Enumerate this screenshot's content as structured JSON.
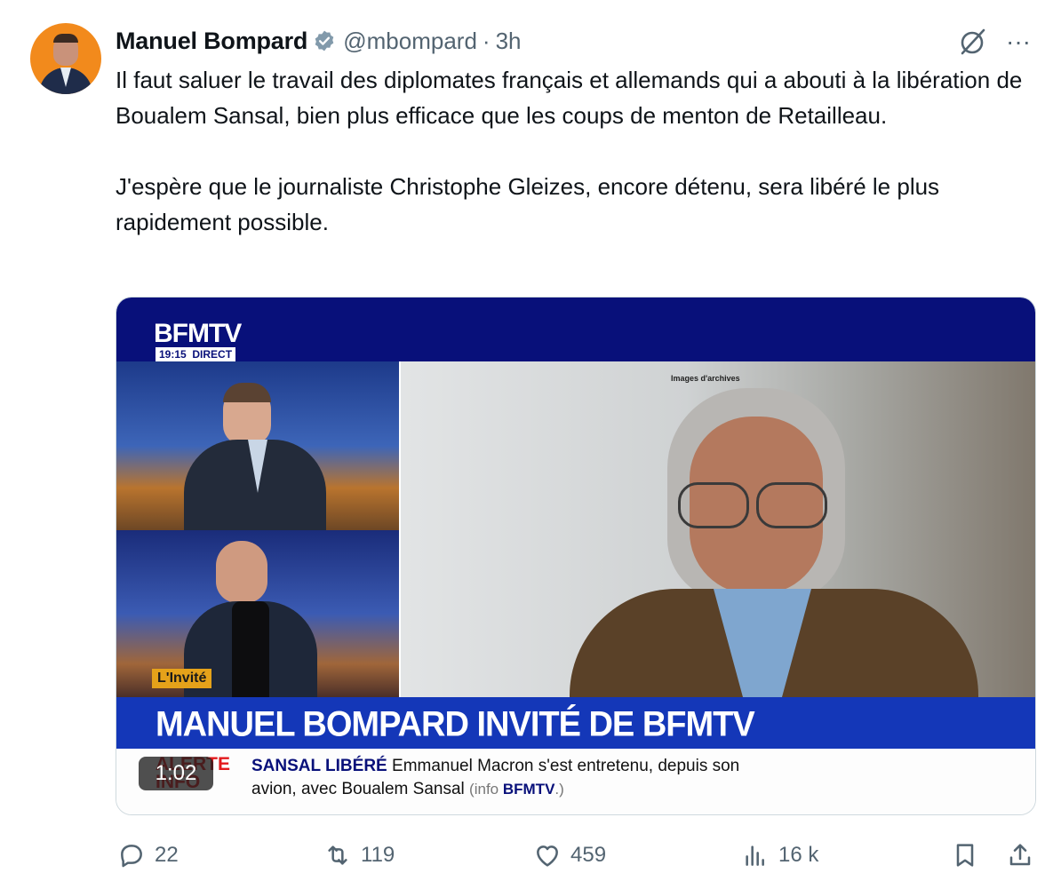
{
  "author": {
    "name": "Manuel Bompard",
    "handle": "@mbompard",
    "separator": "·",
    "time": "3h"
  },
  "colors": {
    "accent": "#1d9bf0",
    "text_secondary": "#536471",
    "verified": "#829aab",
    "bfm_blue": "#08107a",
    "banner_blue": "#1437b8",
    "alert_red": "#e3191c"
  },
  "tweet": {
    "paragraph1": "Il faut saluer le travail des diplomates français et allemands qui a abouti à la libération de Boualem Sansal, bien plus efficace que les coups de menton de Retailleau.",
    "paragraph2": "J'espère que le journaliste Christophe Gleizes, encore détenu, sera libéré le plus rapidement possible."
  },
  "video": {
    "channel_logo": "BFMTV",
    "clock": "19:15",
    "live_label": "DIRECT",
    "archive_label": "Images d'archives",
    "guest_tag": "L'Invité",
    "banner": "MANUEL BOMPARD INVITÉ DE BFMTV",
    "alert_label_1": "ALERTE",
    "alert_label_2": "INFO",
    "ticker_head": "SANSAL LIBÉRÉ",
    "ticker_text_1": "Emmanuel Macron s'est entretenu, depuis son",
    "ticker_text_2": "avion, avec Boualem Sansal",
    "ticker_source_prefix": "(info",
    "ticker_source": "BFMTV",
    "ticker_source_suffix": ".)",
    "duration": "1:02"
  },
  "actions": {
    "replies": "22",
    "reposts": "119",
    "likes": "459",
    "views": "16 k"
  },
  "icons": [
    "verified-badge-icon",
    "grok-icon",
    "more-icon",
    "reply-icon",
    "repost-icon",
    "like-icon",
    "views-icon",
    "bookmark-icon",
    "share-icon"
  ]
}
